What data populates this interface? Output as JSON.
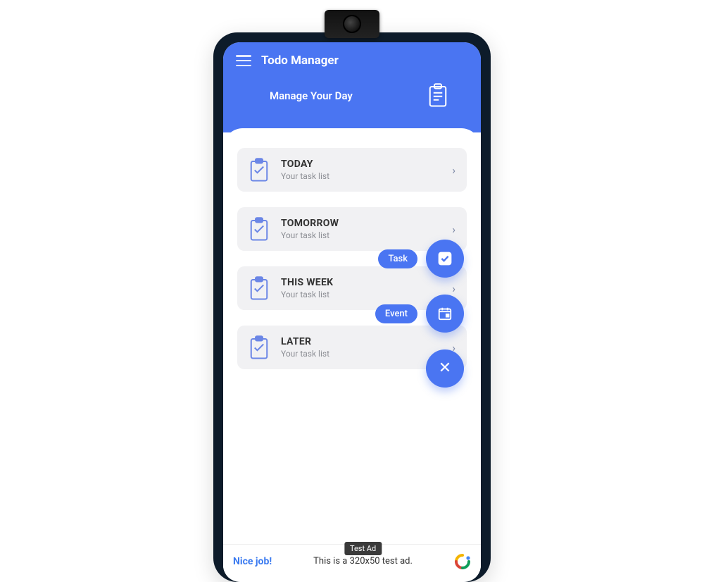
{
  "app": {
    "title": "Todo Manager",
    "subtitle": "Manage Your Day"
  },
  "lists": [
    {
      "title": "TODAY",
      "subtitle": "Your task list"
    },
    {
      "title": "TOMORROW",
      "subtitle": "Your task list"
    },
    {
      "title": "THIS WEEK",
      "subtitle": "Your task list"
    },
    {
      "title": "LATER",
      "subtitle": "Your task list"
    }
  ],
  "fab": {
    "task_label": "Task",
    "event_label": "Event"
  },
  "ad": {
    "nice": "Nice job!",
    "tag": "Test Ad",
    "text": "This is a 320x50 test ad."
  }
}
